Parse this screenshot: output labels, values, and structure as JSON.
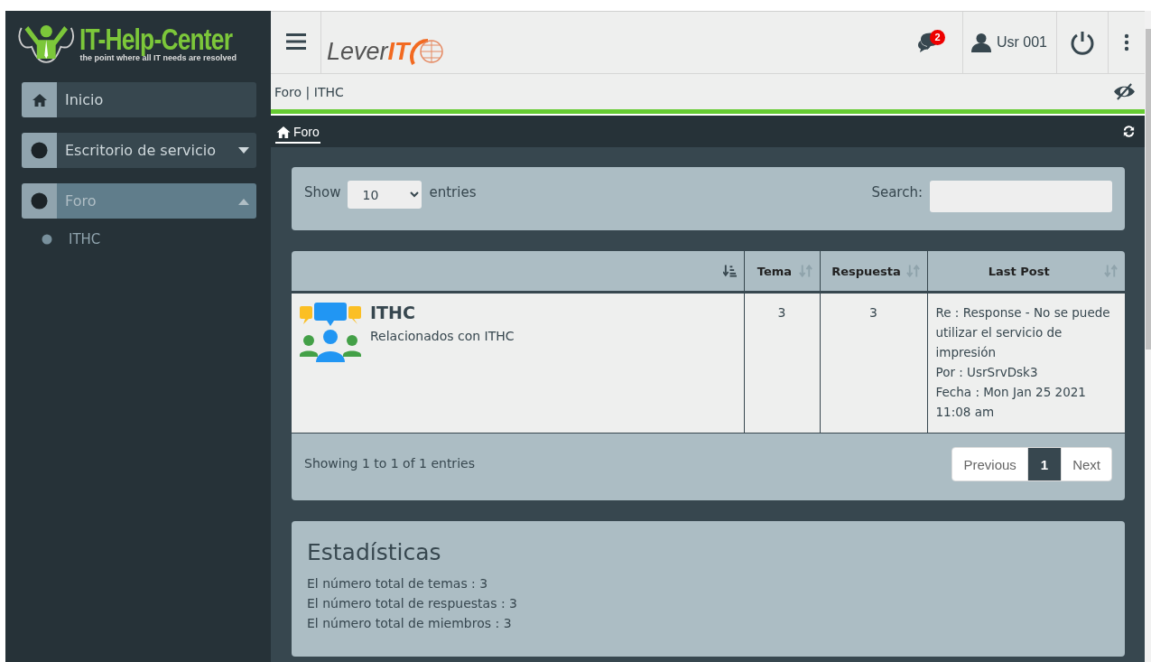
{
  "logo": {
    "title": "IT-Help-Center",
    "tagline": "the point where all IT needs are resolved"
  },
  "sidebar": {
    "items": [
      {
        "label": "Inicio",
        "kind": "home",
        "selected": false
      },
      {
        "label": "Escritorio de servicio",
        "kind": "group",
        "selected": false,
        "expanded": false
      },
      {
        "label": "Foro",
        "kind": "group",
        "selected": true,
        "expanded": true,
        "children": [
          {
            "label": "ITHC",
            "selected": false
          }
        ]
      }
    ]
  },
  "header": {
    "brand_lead": "Lever",
    "brand_tail": "IT",
    "notifications": "2",
    "user": "Usr 001"
  },
  "breadcrumb": "Foro | ITHC",
  "tabs": [
    {
      "label": "Foro",
      "selected": true
    }
  ],
  "table_controls": {
    "show_label": "Show",
    "page_size": "10",
    "entries_label": "entries",
    "search_label": "Search:"
  },
  "table": {
    "columns": [
      {
        "sorted": true
      },
      {
        "label": "Tema",
        "sorted": false
      },
      {
        "label": "Respuesta",
        "sorted": false
      },
      {
        "label": "Last Post",
        "sorted": false
      }
    ],
    "rows": [
      {
        "title": "ITHC",
        "description": "Relacionados con ITHC",
        "tema": "3",
        "respuesta": "3",
        "last_post": [
          "Re : Response - No se puede utilizar el servicio de impresión",
          "Por : UsrSrvDsk3",
          "Fecha : Mon Jan 25 2021 11:08 am"
        ]
      }
    ]
  },
  "footer_info": "Showing 1 to 1 of 1 entries",
  "pagination": [
    {
      "label": "Previous",
      "selected": false
    },
    {
      "label": "1",
      "selected": true
    },
    {
      "label": "Next",
      "selected": false
    }
  ],
  "stats": {
    "title": "Estadísticas",
    "lines": [
      "El número total de temas : 3",
      "El número total de respuestas : 3",
      "El número total de miembros : 3"
    ]
  }
}
